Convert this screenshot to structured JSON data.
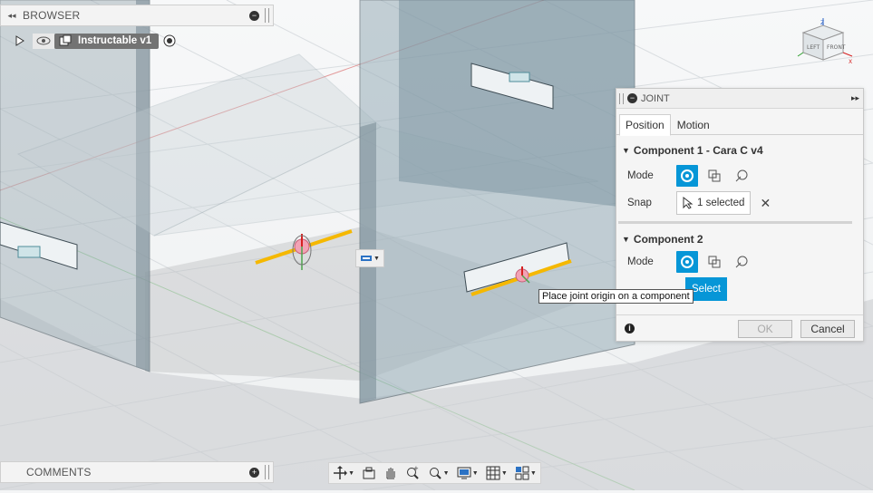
{
  "browser": {
    "title": "BROWSER",
    "document_name": "Instructable v1"
  },
  "comments": {
    "title": "COMMENTS"
  },
  "joint_dialog": {
    "title": "JOINT",
    "tabs": [
      {
        "label": "Position"
      },
      {
        "label": "Motion"
      }
    ],
    "component1": {
      "title": "Component 1 - Cara C v4",
      "mode_label": "Mode",
      "snap_label": "Snap",
      "snap_value": "1 selected"
    },
    "component2": {
      "title": "Component 2",
      "mode_label": "Mode",
      "select_label": "Select"
    },
    "ok_label": "OK",
    "cancel_label": "Cancel"
  },
  "tooltip": {
    "text": "Place joint origin on a component"
  },
  "viewcube": {
    "face_left": "LEFT",
    "face_front": "FRONT",
    "axis_z": "Z",
    "axis_x": "X"
  },
  "nav_toolbar": {
    "icons": [
      "orbit-icon",
      "look-at-icon",
      "pan-icon",
      "zoom-icon",
      "fit-icon",
      "display-settings-icon",
      "grid-settings-icon",
      "viewports-icon"
    ]
  },
  "colors": {
    "accent": "#0696d7",
    "joint_axis": "#f5b800",
    "body_tint": "#9fb3bd"
  }
}
